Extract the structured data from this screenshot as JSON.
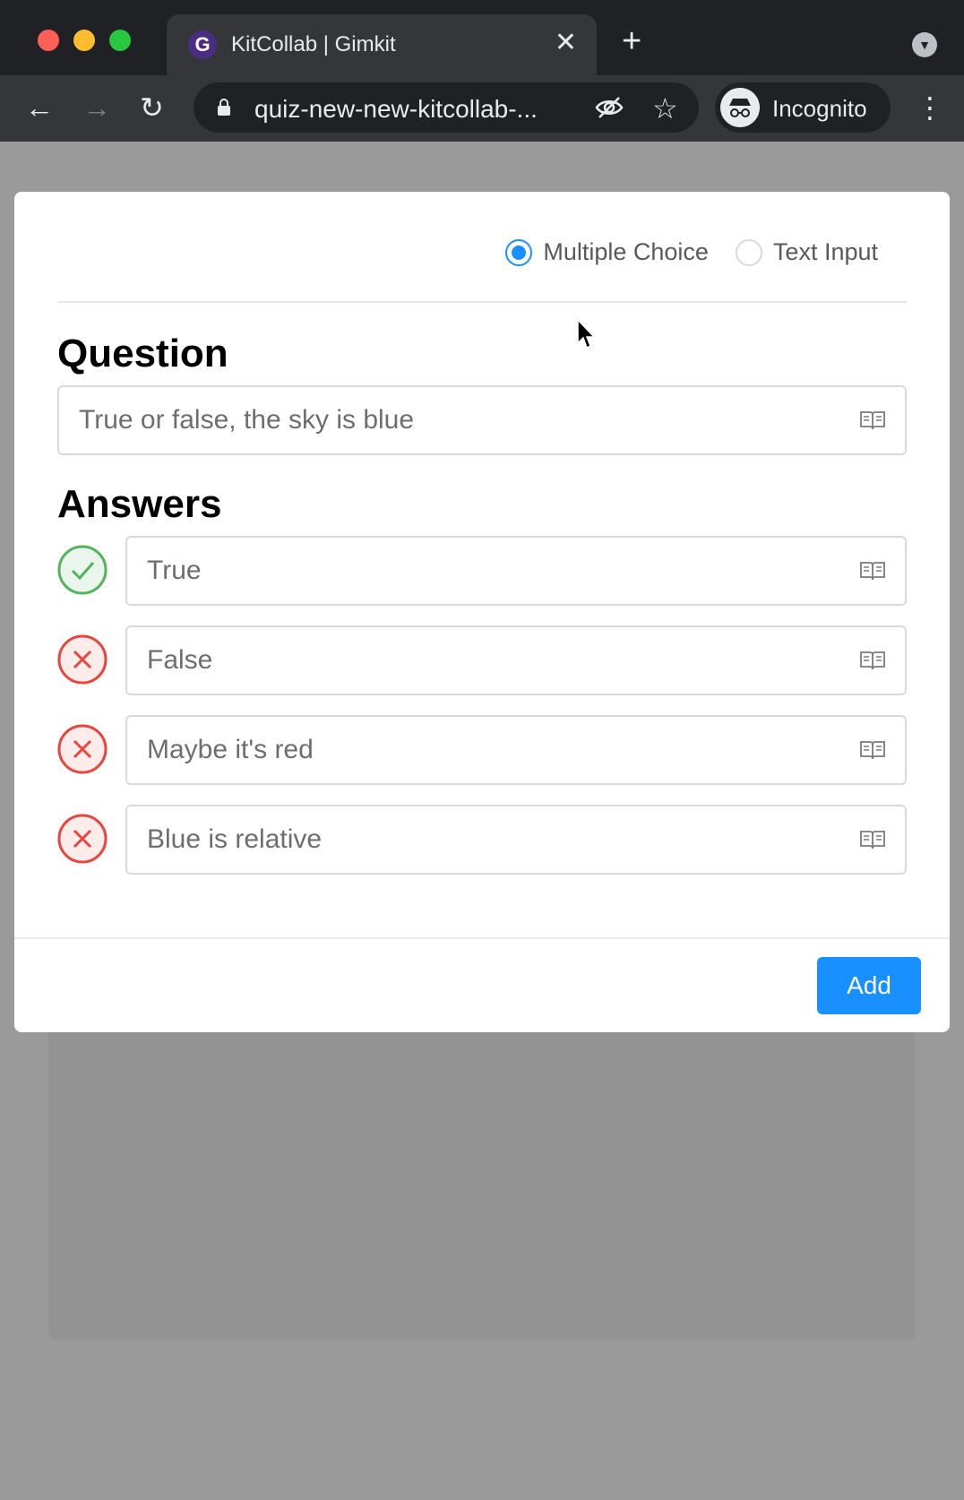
{
  "browser": {
    "tab_title": "KitCollab | Gimkit",
    "tab_favicon": "G",
    "tab_close": "✕",
    "new_tab": "+",
    "url": "quiz-new-new-kitcollab-...",
    "profile_label": "Incognito"
  },
  "modal": {
    "question_types": [
      {
        "label": "Multiple Choice",
        "selected": true
      },
      {
        "label": "Text Input",
        "selected": false
      }
    ],
    "question_heading": "Question",
    "question_text": "True or false, the sky is blue",
    "answers_heading": "Answers",
    "answers": [
      {
        "text": "True",
        "correct": true
      },
      {
        "text": "False",
        "correct": false
      },
      {
        "text": "Maybe it's red",
        "correct": false
      },
      {
        "text": "Blue is relative",
        "correct": false
      }
    ],
    "add_label": "Add"
  },
  "colors": {
    "primary": "#1890ff",
    "correct": "#52b35a",
    "incorrect": "#e8453c",
    "overlay": "#9a9a9a"
  },
  "icons": {
    "image_upload": "book-icon",
    "correct": "check-circle-icon",
    "incorrect": "x-circle-icon"
  }
}
